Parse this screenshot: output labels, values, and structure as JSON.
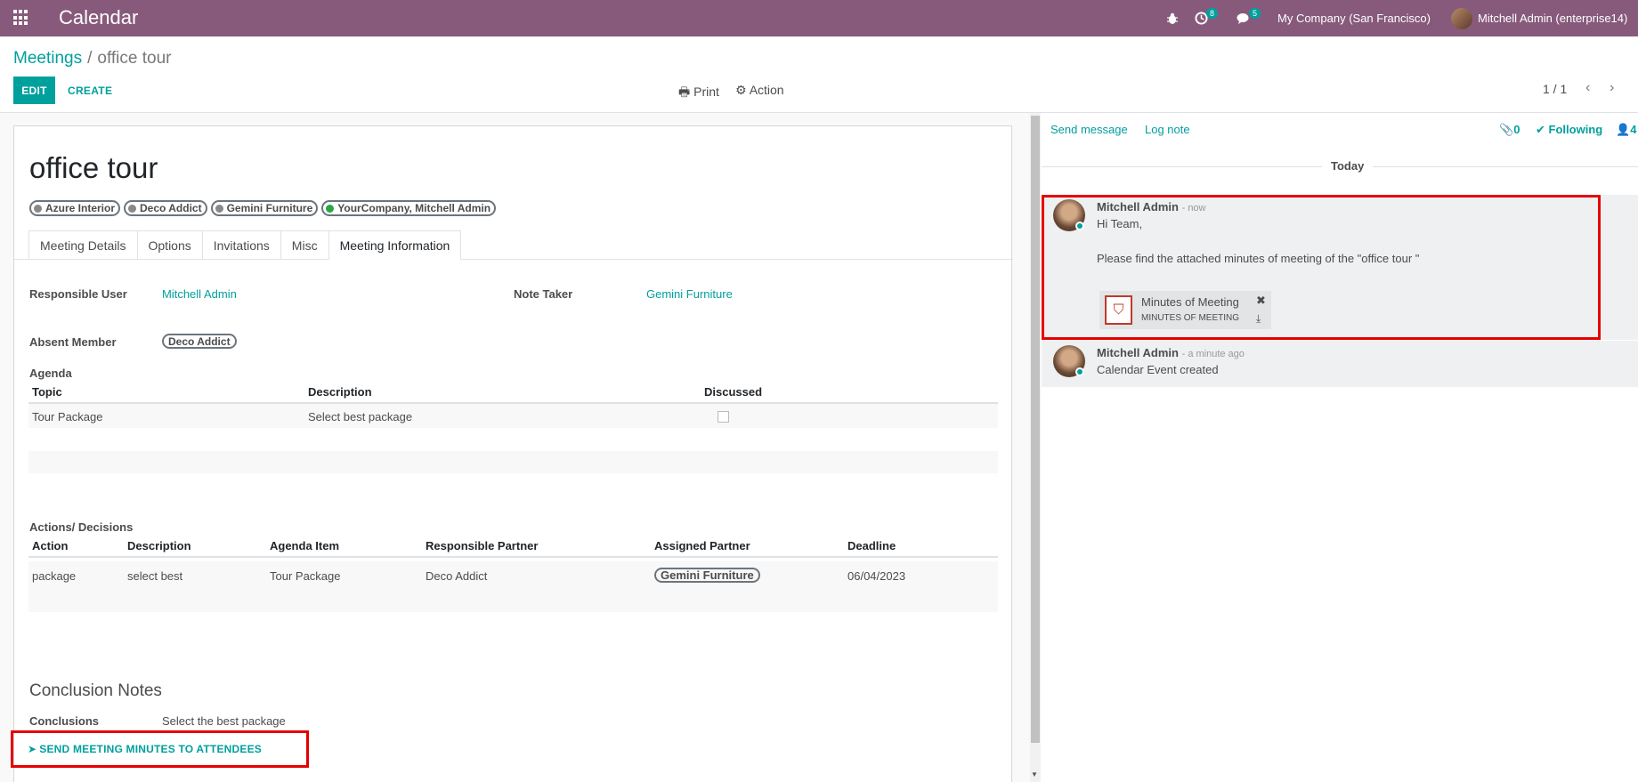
{
  "navbar": {
    "app_name": "Calendar",
    "activity_badge": "8",
    "messages_badge": "5",
    "company": "My Company (San Francisco)",
    "user": "Mitchell Admin (enterprise14)"
  },
  "breadcrumb": {
    "parent": "Meetings",
    "separator": "/",
    "current": "office tour"
  },
  "toolbar": {
    "edit": "EDIT",
    "create": "CREATE",
    "print": "Print",
    "action": "Action"
  },
  "pager": {
    "value": "1 / 1",
    "prev": "‹",
    "next": "›"
  },
  "record": {
    "title": "office tour",
    "attendees": [
      "Azure Interior",
      "Deco Addict",
      "Gemini Furniture",
      "YourCompany, Mitchell Admin"
    ]
  },
  "tabs": [
    "Meeting Details",
    "Options",
    "Invitations",
    "Misc",
    "Meeting Information"
  ],
  "meeting_info": {
    "responsible_user_label": "Responsible User",
    "responsible_user": "Mitchell Admin",
    "note_taker_label": "Note Taker",
    "note_taker": "Gemini Furniture",
    "absent_member_label": "Absent Member",
    "absent_member": "Deco Addict",
    "agenda_label": "Agenda",
    "agenda_headers": [
      "Topic",
      "Description",
      "Discussed"
    ],
    "agenda_rows": [
      {
        "topic": "Tour Package",
        "description": "Select best package"
      }
    ],
    "actions_label": "Actions/ Decisions",
    "actions_headers": [
      "Action",
      "Description",
      "Agenda Item",
      "Responsible Partner",
      "Assigned Partner",
      "Deadline"
    ],
    "actions_rows": [
      {
        "action": "package",
        "description": "select best",
        "agenda_item": "Tour Package",
        "responsible": "Deco Addict",
        "assigned": "Gemini Furniture",
        "deadline": "06/04/2023"
      }
    ],
    "conclusion_header": "Conclusion Notes",
    "conclusions_label": "Conclusions",
    "conclusions": "Select the best package",
    "send_button": "SEND MEETING MINUTES TO ATTENDEES"
  },
  "chatter": {
    "send_message": "Send message",
    "log_note": "Log note",
    "attachments_count": "0",
    "following": "Following",
    "followers_count": "4",
    "today": "Today",
    "messages": [
      {
        "author": "Mitchell Admin",
        "time": "- now",
        "line1": "Hi  Team,",
        "line2": "Please find the attached minutes of meeting of the \"office tour \"",
        "attachment_name": "Minutes of Meeting",
        "attachment_type": "MINUTES OF MEETING"
      },
      {
        "author": "Mitchell Admin",
        "time": "- a minute ago",
        "line1": "Calendar Event created"
      }
    ]
  },
  "colors": {
    "brand": "#875a7b",
    "accent": "#00a09d",
    "highlight": "#e60000"
  }
}
